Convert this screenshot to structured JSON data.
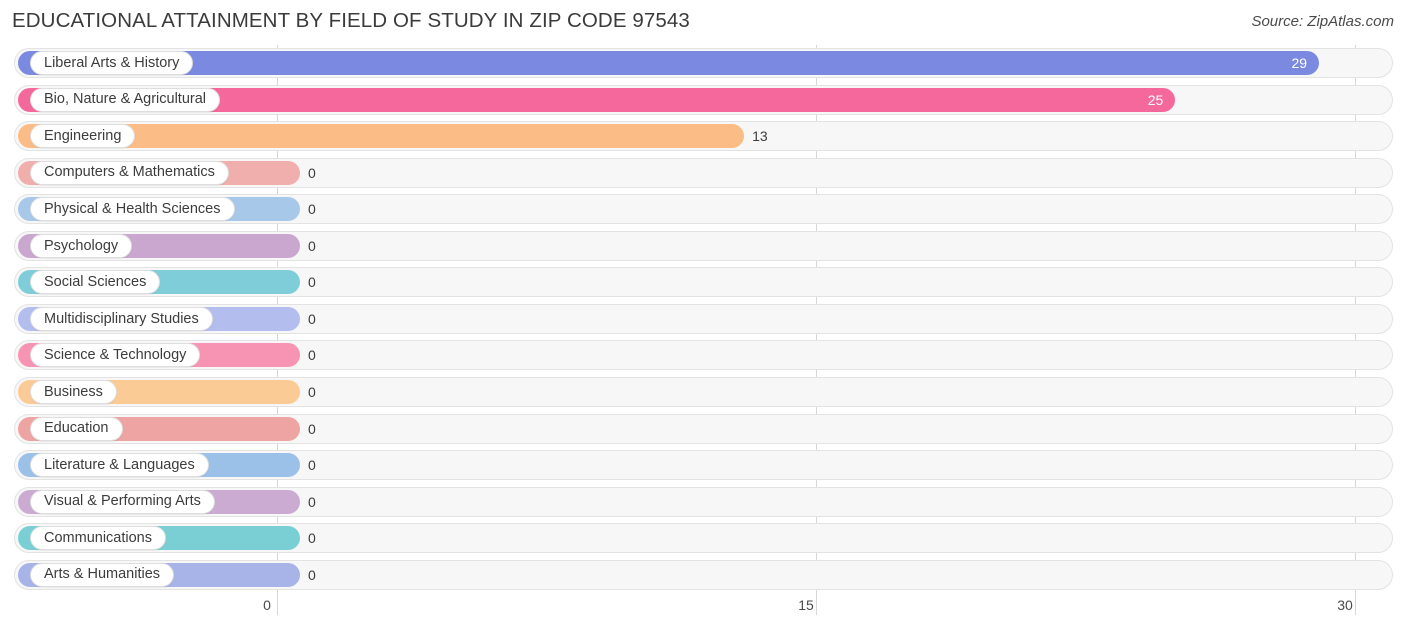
{
  "header": {
    "title": "EDUCATIONAL ATTAINMENT BY FIELD OF STUDY IN ZIP CODE 97543",
    "source": "Source: ZipAtlas.com"
  },
  "chart_data": {
    "type": "bar",
    "orientation": "horizontal",
    "title": "EDUCATIONAL ATTAINMENT BY FIELD OF STUDY IN ZIP CODE 97543",
    "xlabel": "",
    "ylabel": "",
    "xlim": [
      0,
      30
    ],
    "xticks": [
      0,
      15,
      30
    ],
    "xtick_labels": [
      "0",
      "15",
      "30"
    ],
    "grid": true,
    "legend": "none",
    "categories": [
      "Liberal Arts & History",
      "Bio, Nature & Agricultural",
      "Engineering",
      "Computers & Mathematics",
      "Physical & Health Sciences",
      "Psychology",
      "Social Sciences",
      "Multidisciplinary Studies",
      "Science & Technology",
      "Business",
      "Education",
      "Literature & Languages",
      "Visual & Performing Arts",
      "Communications",
      "Arts & Humanities"
    ],
    "values": [
      29,
      25,
      13,
      0,
      0,
      0,
      0,
      0,
      0,
      0,
      0,
      0,
      0,
      0,
      0
    ],
    "value_labels": [
      "29",
      "25",
      "13",
      "0",
      "0",
      "0",
      "0",
      "0",
      "0",
      "0",
      "0",
      "0",
      "0",
      "0",
      "0"
    ],
    "colors": [
      "#7b8ae0",
      "#f4689b",
      "#fbbd85",
      "#f0aeac",
      "#a8c8ea",
      "#c9a7ce",
      "#7ecdd8",
      "#b3bdee",
      "#f794b4",
      "#fbcb96",
      "#eda4a2",
      "#9cc1e8",
      "#cbabd2",
      "#79cfd4",
      "#a8b3e8"
    ]
  },
  "axis": {
    "ticks": [
      {
        "label": "0",
        "value": 0
      },
      {
        "label": "15",
        "value": 15
      },
      {
        "label": "30",
        "value": 30
      }
    ]
  }
}
